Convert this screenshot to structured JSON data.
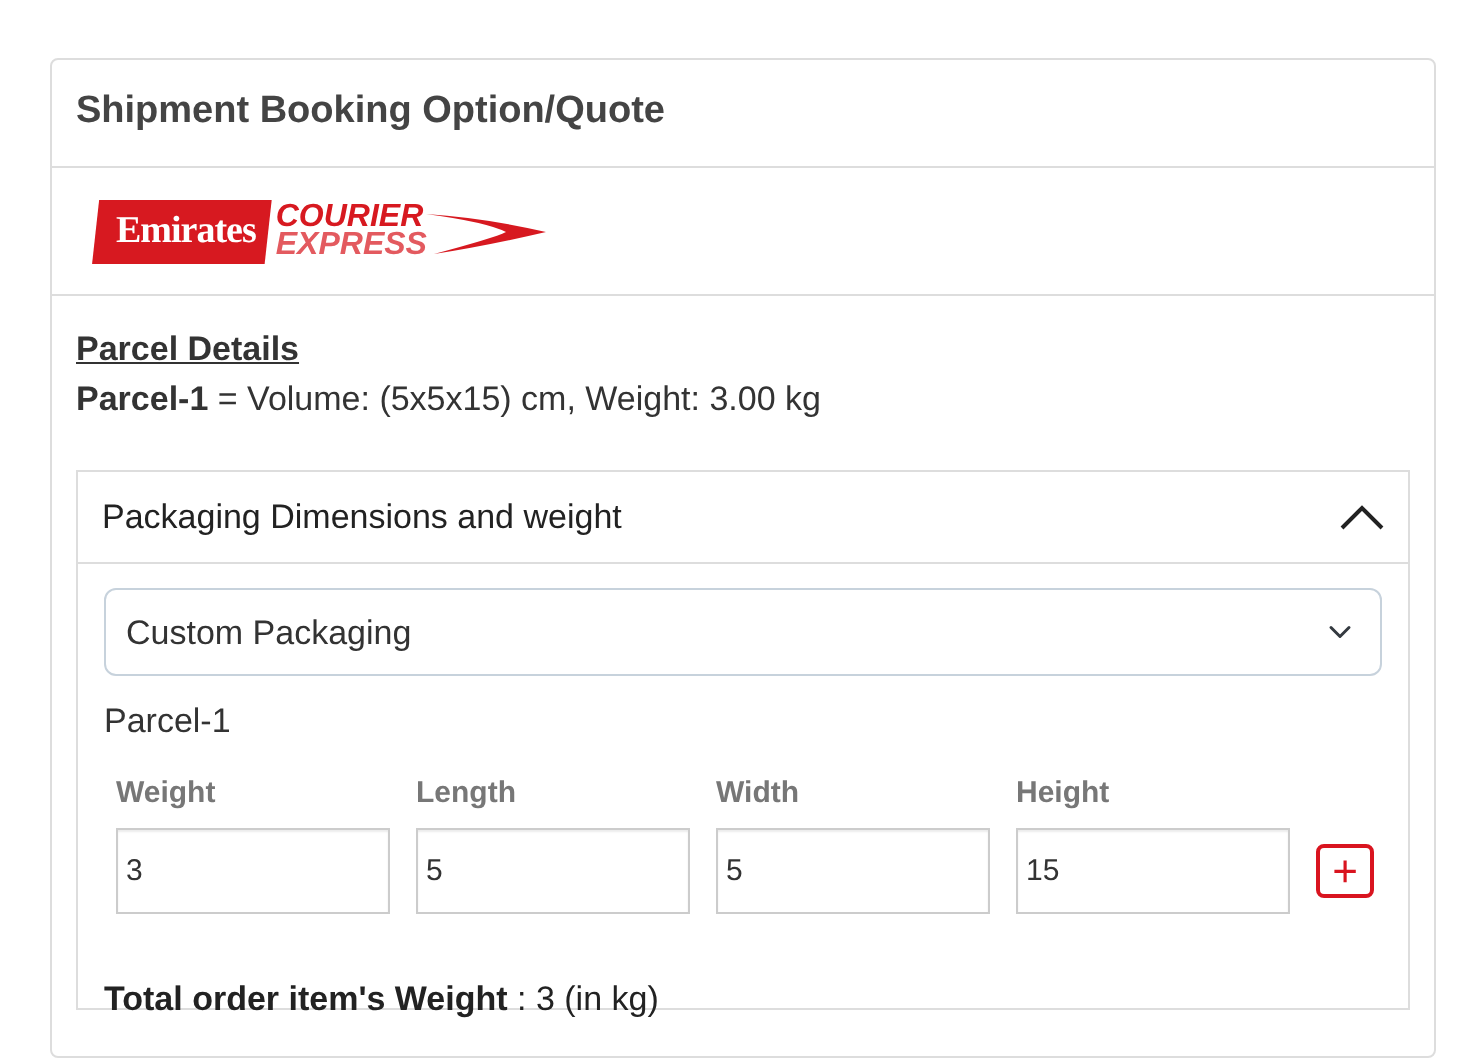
{
  "card": {
    "title": "Shipment Booking Option/Quote"
  },
  "logo": {
    "brand": "Emirates",
    "line_1": "COURIER",
    "line_2": "EXPRESS"
  },
  "parcel_details": {
    "heading": "Parcel Details",
    "lines": [
      {
        "name": "Parcel-1",
        "text": " = Volume: (5x5x15) cm, Weight: 3.00 kg"
      }
    ]
  },
  "accordion": {
    "title": "Packaging Dimensions and weight",
    "expanded": true,
    "packaging_select": {
      "value": "Custom Packaging"
    },
    "parcels": [
      {
        "label": "Parcel-1",
        "fields": [
          {
            "label": "Weight",
            "value": "3"
          },
          {
            "label": "Length",
            "value": "5"
          },
          {
            "label": "Width",
            "value": "5"
          },
          {
            "label": "Height",
            "value": "15"
          }
        ],
        "add_button": "+"
      }
    ],
    "total": {
      "label": "Total order item's Weight",
      "value": " : 3 (in kg)"
    }
  }
}
